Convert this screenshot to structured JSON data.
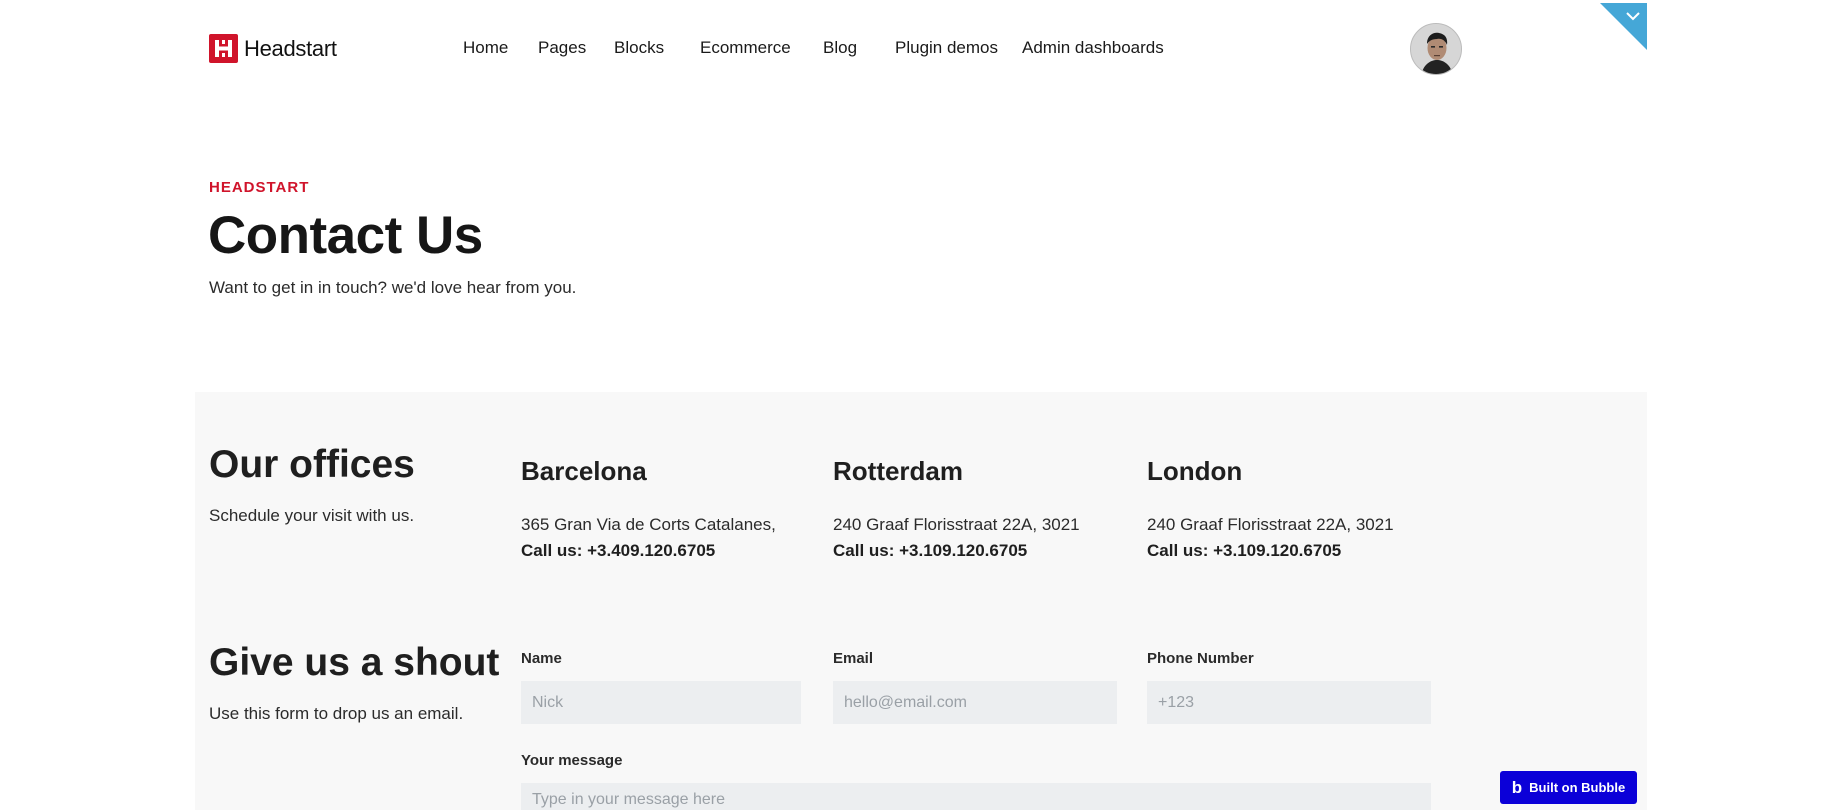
{
  "nav": {
    "logo_text": "Headstart",
    "links": [
      {
        "label": "Home"
      },
      {
        "label": "Pages"
      },
      {
        "label": "Blocks"
      },
      {
        "label": "Ecommerce"
      },
      {
        "label": "Blog"
      },
      {
        "label": "Plugin demos"
      },
      {
        "label": "Admin dashboards"
      }
    ],
    "avatar_icon": "user-avatar",
    "corner_icon": "chevron-down-icon"
  },
  "hero": {
    "eyebrow": "HEADSTART",
    "title": "Contact Us",
    "subtitle": "Want to get in in touch? we'd love hear from you."
  },
  "offices": {
    "title": "Our offices",
    "subtitle": "Schedule your visit with us.",
    "items": [
      {
        "city": "Barcelona",
        "address": "365 Gran Via de Corts Catalanes,",
        "phone": "Call us: +3.409.120.6705"
      },
      {
        "city": "Rotterdam",
        "address": "240 Graaf Florisstraat 22A, 3021",
        "phone": "Call us: +3.109.120.6705"
      },
      {
        "city": "London",
        "address": "240 Graaf Florisstraat 22A, 3021",
        "phone": "Call us: +3.109.120.6705"
      }
    ]
  },
  "form": {
    "title": "Give us a shout",
    "subtitle": "Use this form to drop us an email.",
    "name": {
      "label": "Name",
      "placeholder": "Nick",
      "value": ""
    },
    "email": {
      "label": "Email",
      "placeholder": "hello@email.com",
      "value": ""
    },
    "phone": {
      "label": "Phone Number",
      "placeholder": "+123",
      "value": ""
    },
    "message": {
      "label": "Your message",
      "placeholder": "Type in your message here",
      "value": ""
    }
  },
  "badge": {
    "label": "Built on Bubble",
    "icon": "b"
  },
  "colors": {
    "brand_red": "#d0142b",
    "corner_blue": "#45a7d7",
    "bubble_blue": "#0b00d8",
    "section_bg": "#f8f8f8",
    "input_bg": "#eceef0"
  }
}
